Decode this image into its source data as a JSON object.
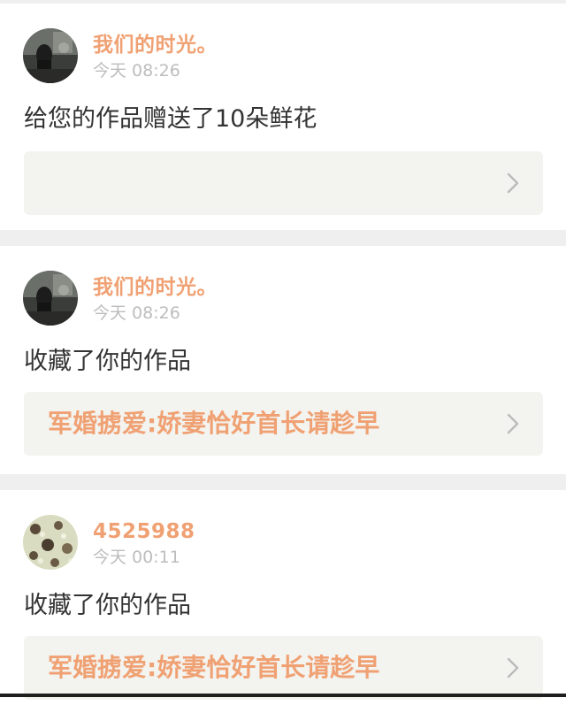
{
  "colors": {
    "accent": "#f0a173",
    "body_text": "#333333",
    "time_text": "#bdbdbd",
    "card_bg": "#ffffff",
    "work_bg": "#f3f3ef",
    "page_bg": "#efefef",
    "chevron": "#bbbbbb"
  },
  "notifications": [
    {
      "username": "我们的时光。",
      "time": "今天 08:26",
      "action": "给您的作品赠送了10朵鲜花",
      "work_title": "",
      "avatar_icon": "dark-photo-avatar",
      "chevron_icon": "chevron-right-icon"
    },
    {
      "username": "我们的时光。",
      "time": "今天 08:26",
      "action": "收藏了你的作品",
      "work_title": "军婚掳爱:娇妻恰好首长请趁早",
      "avatar_icon": "dark-photo-avatar",
      "chevron_icon": "chevron-right-icon"
    },
    {
      "username": "4525988",
      "time": "今天 00:11",
      "action": "收藏了你的作品",
      "work_title": "军婚掳爱:娇妻恰好首长请趁早",
      "avatar_icon": "floral-photo-avatar",
      "chevron_icon": "chevron-right-icon"
    }
  ]
}
